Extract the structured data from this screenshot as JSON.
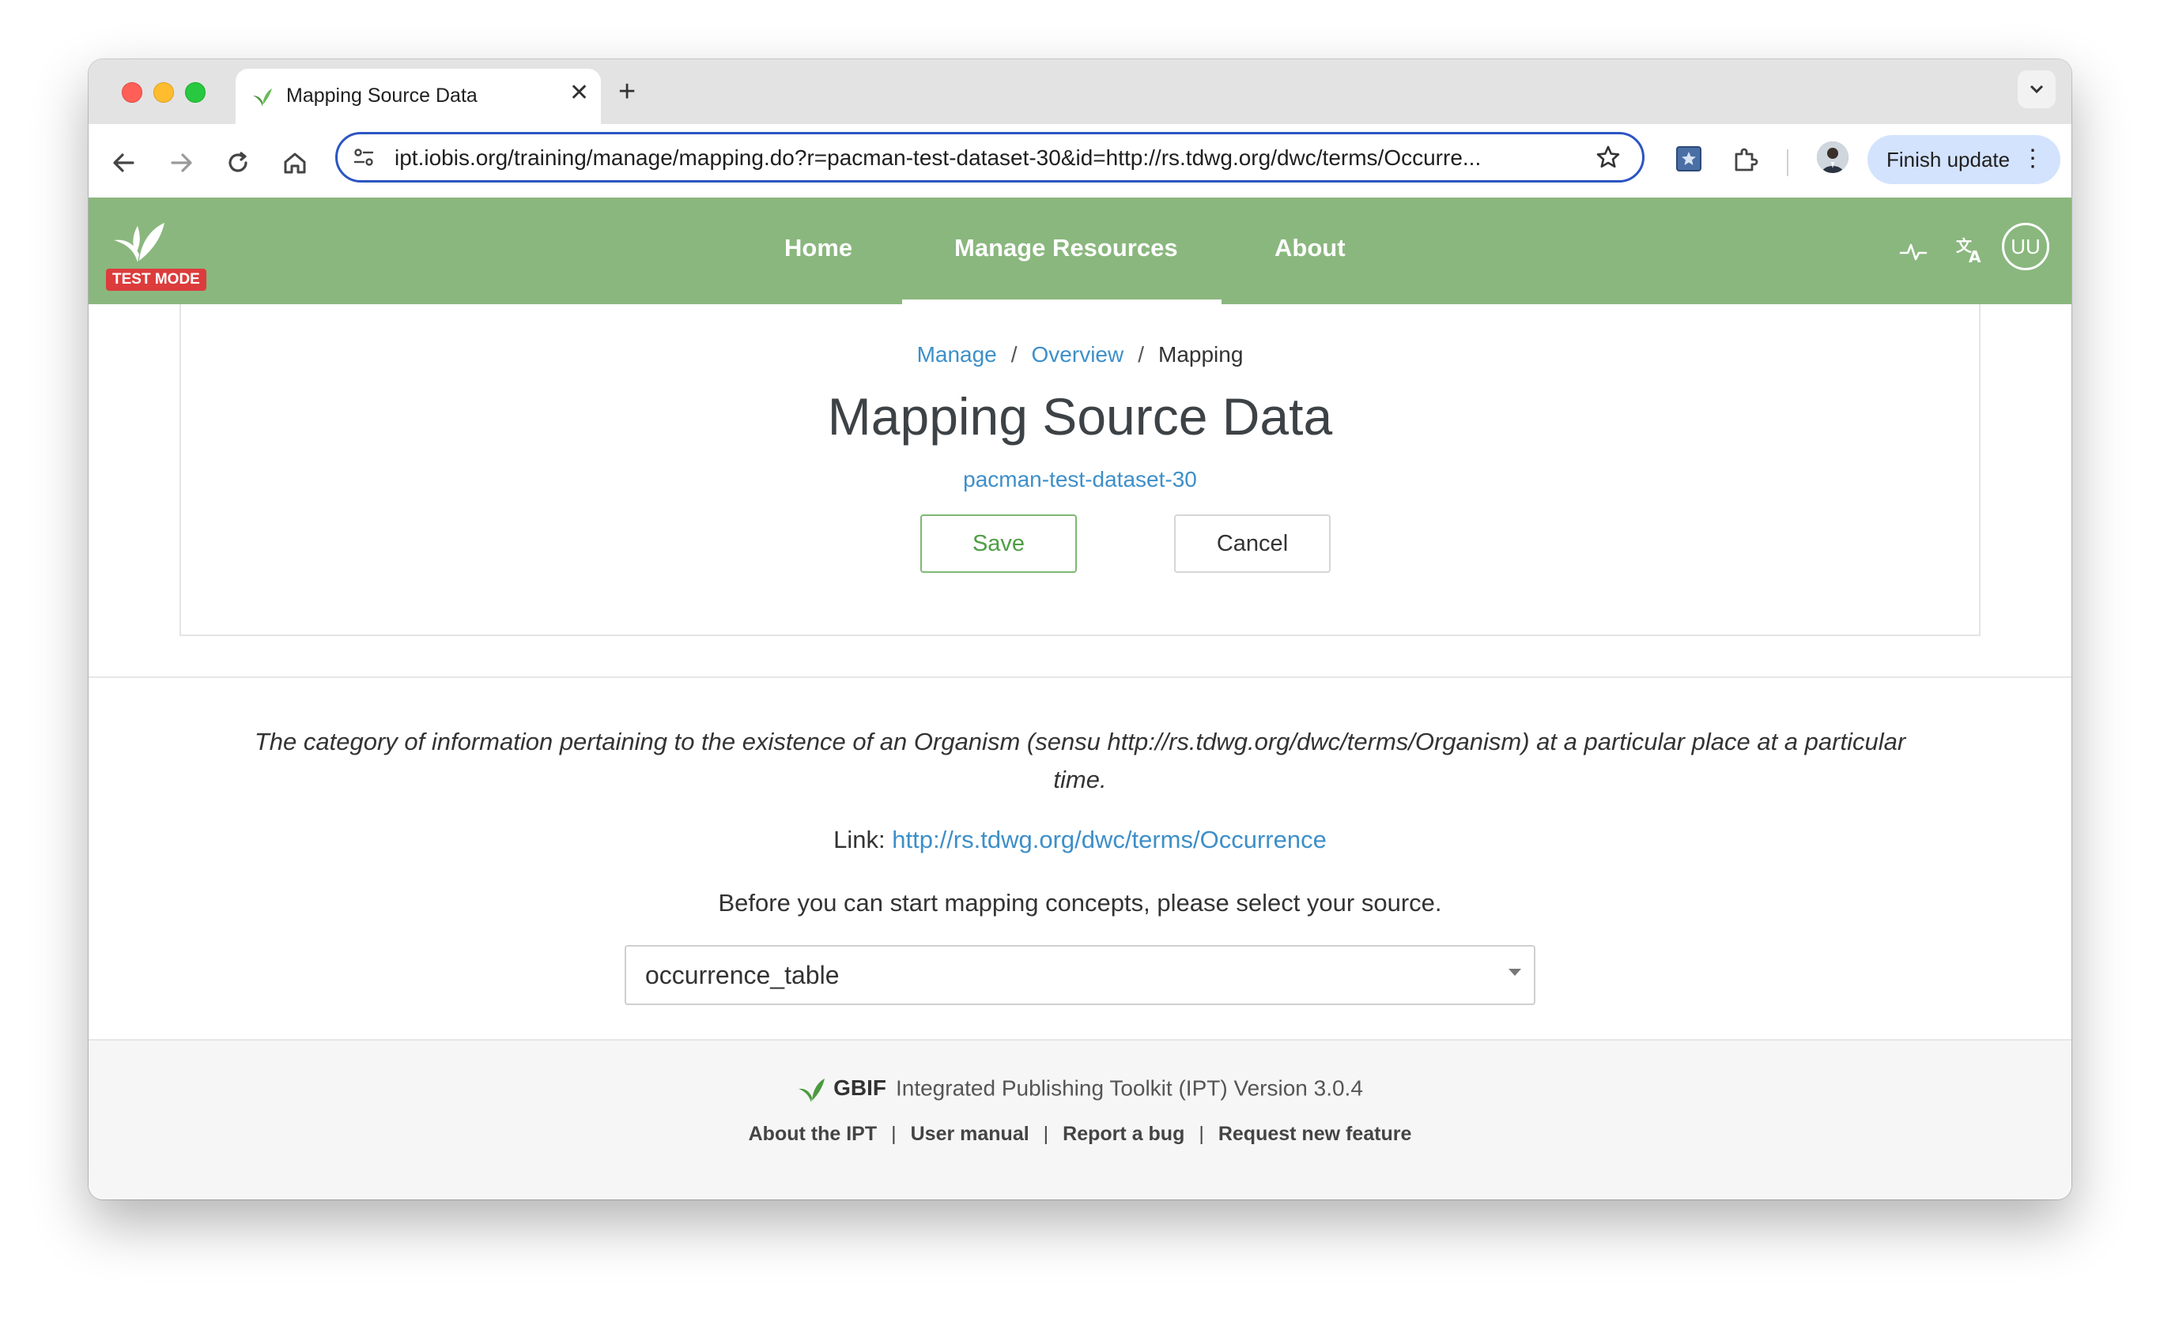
{
  "browser": {
    "tab_title": "Mapping Source Data",
    "url": "ipt.iobis.org/training/manage/mapping.do?r=pacman-test-dataset-30&id=http://rs.tdwg.org/dwc/terms/Occurre...",
    "finish_update_label": "Finish update"
  },
  "header": {
    "badge": "TEST MODE",
    "nav": [
      "Home",
      "Manage Resources",
      "About"
    ],
    "user_initials": "UU",
    "bg_color": "#8ab77e"
  },
  "breadcrumb": {
    "items": [
      "Manage",
      "Overview"
    ],
    "current": "Mapping",
    "separator": "/"
  },
  "page": {
    "title": "Mapping Source Data",
    "resource": "pacman-test-dataset-30",
    "save_label": "Save",
    "cancel_label": "Cancel"
  },
  "mapping": {
    "description": "The category of information pertaining to the existence of an Organism (sensu http://rs.tdwg.org/dwc/terms/Organism) at a particular place at a particular time.",
    "link_label": "Link:",
    "link_url": "http://rs.tdwg.org/dwc/terms/Occurrence",
    "instruction": "Before you can start mapping concepts, please select your source.",
    "source_selected": "occurrence_table"
  },
  "footer": {
    "gbif": "GBIF",
    "toolkit": "Integrated Publishing Toolkit (IPT) Version 3.0.4",
    "links": [
      "About the IPT",
      "User manual",
      "Report a bug",
      "Request new feature"
    ]
  }
}
